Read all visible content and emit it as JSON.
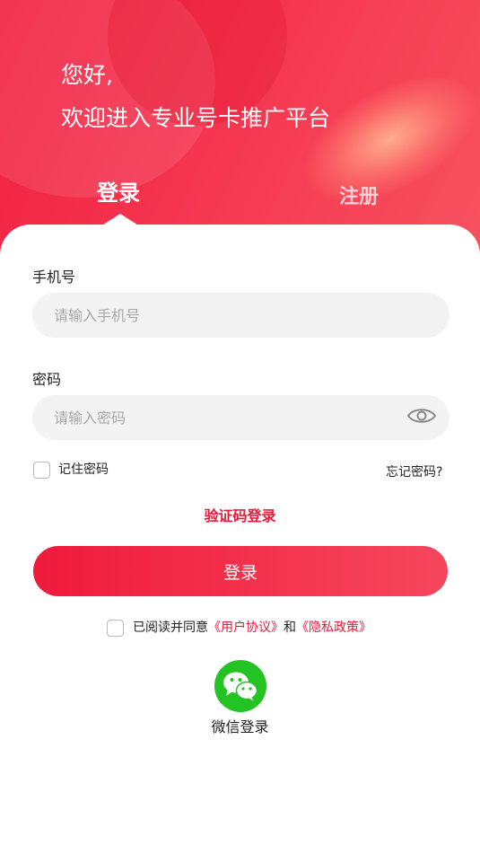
{
  "header": {
    "greeting_line1": "您好,",
    "greeting_line2": "欢迎进入专业号卡推广平台",
    "tab_login": "登录",
    "tab_register": "注册"
  },
  "form": {
    "phone_label": "手机号",
    "phone_placeholder": "请输入手机号",
    "password_label": "密码",
    "password_placeholder": "请输入密码",
    "password_visibility_icon": "eye-icon",
    "remember_label": "记住密码",
    "forgot_label": "忘记密码?",
    "code_login_label": "验证码登录",
    "submit_label": "登录"
  },
  "agreement": {
    "prefix": "已阅读并同意",
    "user_agreement": "《用户协议》",
    "conjunction": "和",
    "privacy_policy": "《隐私政策》"
  },
  "wechat": {
    "icon": "wechat-icon",
    "label": "微信登录"
  },
  "colors": {
    "accent": "#e8193a",
    "header_start": "#f01f40",
    "header_end": "#f7525f",
    "wechat_green": "#22c322"
  }
}
